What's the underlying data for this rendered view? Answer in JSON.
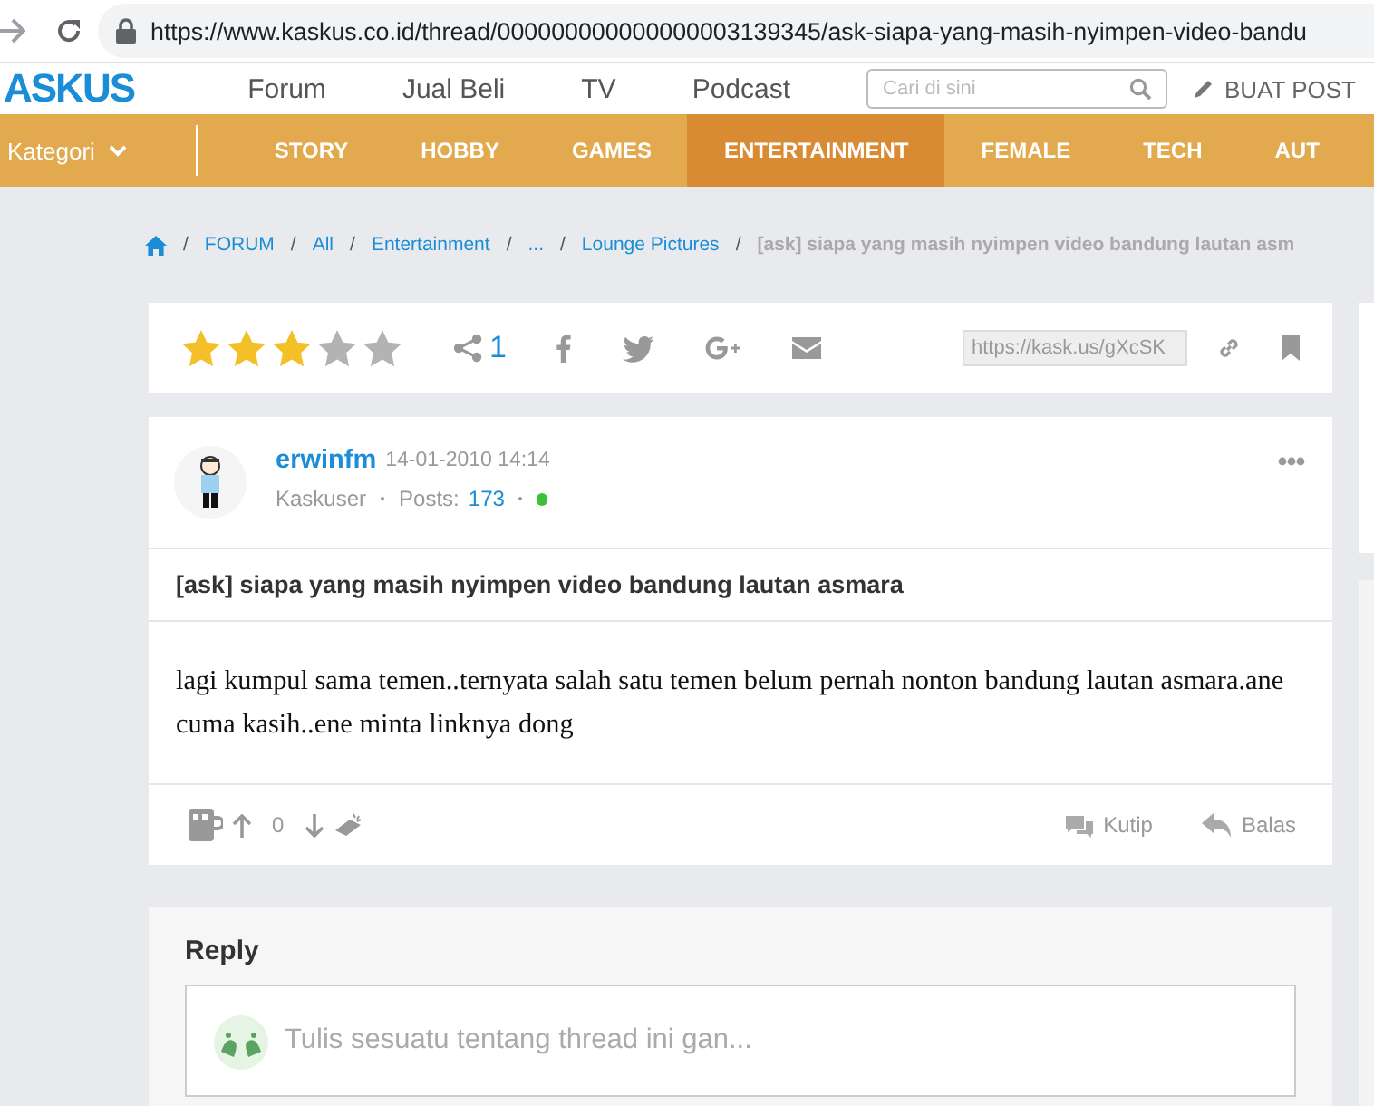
{
  "browser": {
    "url": "https://www.kaskus.co.id/thread/000000000000000003139345/ask-siapa-yang-masih-nyimpen-video-bandu"
  },
  "header": {
    "logo": "ASKUS",
    "links": [
      "Forum",
      "Jual Beli",
      "TV",
      "Podcast"
    ],
    "search": {
      "placeholder": "Cari di sini"
    },
    "create_button": "BUAT POST"
  },
  "nav": {
    "category": "Kategori",
    "items": [
      {
        "label": "STORY",
        "selected": false
      },
      {
        "label": "HOBBY",
        "selected": false
      },
      {
        "label": "GAMES",
        "selected": false
      },
      {
        "label": "ENTERTAINMENT",
        "selected": true
      },
      {
        "label": "FEMALE",
        "selected": false
      },
      {
        "label": "TECH",
        "selected": false
      },
      {
        "label": "AUT",
        "selected": false
      }
    ]
  },
  "breadcrumb_separator": "/",
  "breadcrumb": [
    {
      "label": "FORUM",
      "kind": "link"
    },
    {
      "label": "All",
      "kind": "link"
    },
    {
      "label": "Entertainment",
      "kind": "link"
    },
    {
      "label": "...",
      "kind": "link"
    },
    {
      "label": "Lounge Pictures",
      "kind": "link"
    },
    {
      "label": "[ask] siapa yang masih nyimpen video bandung lautan asm",
      "kind": "current"
    }
  ],
  "share_bar": {
    "stars": 3,
    "share_count": "1",
    "short_url": "https://kask.us/gXcSK"
  },
  "post": {
    "username": "erwinfm",
    "date": "14-01-2010 14:14",
    "rank": "Kaskuser",
    "posts_label": "Posts:",
    "posts": "173",
    "online": true,
    "title": "[ask] siapa yang masih nyimpen video bandung lautan asmara",
    "body": "lagi kumpul sama temen..ternyata salah satu temen belum pernah nonton bandung lautan asmara.ane cuma kasih..ene minta linknya dong",
    "votes": "0",
    "actions": [
      {
        "label": "Kutip",
        "kind": "quote"
      },
      {
        "label": "Balas",
        "kind": "reply"
      }
    ]
  },
  "reply": {
    "heading": "Reply",
    "placeholder": "Tulis sesuatu tentang thread ini gan..."
  }
}
